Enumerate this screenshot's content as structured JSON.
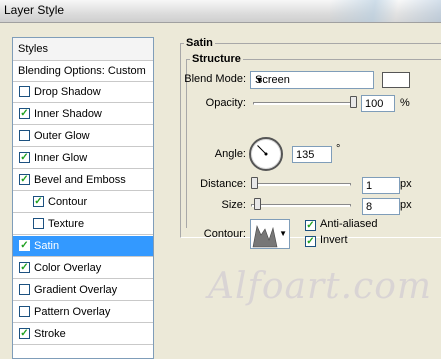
{
  "window": {
    "title": "Layer Style"
  },
  "styles": {
    "header": "Styles",
    "blending": "Blending Options: Custom",
    "items": [
      {
        "label": "Drop Shadow",
        "checked": false
      },
      {
        "label": "Inner Shadow",
        "checked": true
      },
      {
        "label": "Outer Glow",
        "checked": false
      },
      {
        "label": "Inner Glow",
        "checked": true
      },
      {
        "label": "Bevel and Emboss",
        "checked": true
      },
      {
        "label": "Contour",
        "checked": true
      },
      {
        "label": "Texture",
        "checked": false
      },
      {
        "label": "Satin",
        "checked": true
      },
      {
        "label": "Color Overlay",
        "checked": true
      },
      {
        "label": "Gradient Overlay",
        "checked": false
      },
      {
        "label": "Pattern Overlay",
        "checked": false
      },
      {
        "label": "Stroke",
        "checked": true
      }
    ],
    "selected": "Satin"
  },
  "satin": {
    "group_title": "Satin",
    "structure_title": "Structure",
    "blend_mode_label": "Blend Mode:",
    "blend_mode_value": "Screen",
    "blend_color": "#ffffff",
    "opacity_label": "Opacity:",
    "opacity_value": "100",
    "opacity_unit": "%",
    "opacity_fraction": 1.0,
    "angle_label": "Angle:",
    "angle_value": "135",
    "angle_unit": "°",
    "distance_label": "Distance:",
    "distance_value": "1",
    "distance_unit": "px",
    "distance_fraction": 0.0,
    "size_label": "Size:",
    "size_value": "8",
    "size_unit": "px",
    "size_fraction": 0.03,
    "contour_label": "Contour:",
    "anti_aliased_label": "Anti-aliased",
    "anti_aliased_checked": true,
    "invert_label": "Invert",
    "invert_checked": true
  },
  "watermark": "Alfoart.com"
}
